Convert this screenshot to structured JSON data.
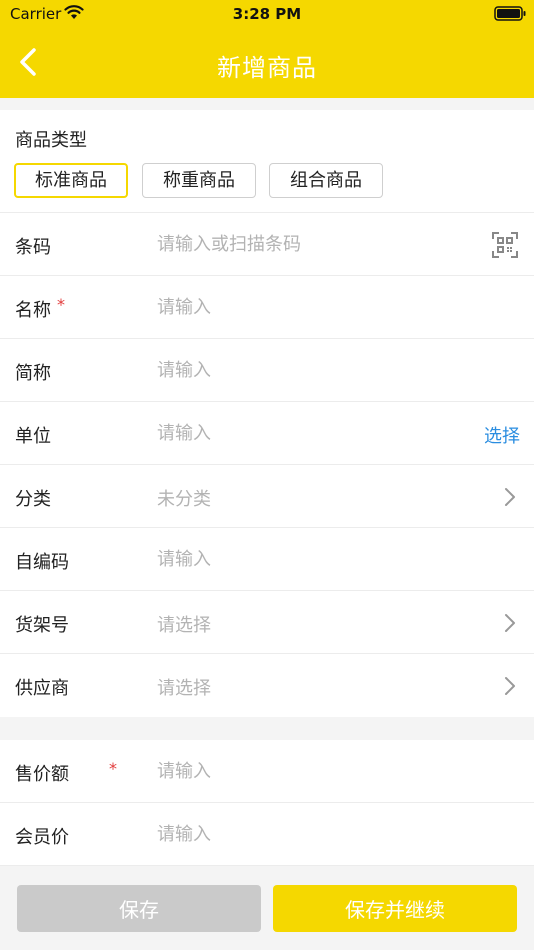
{
  "status_bar": {
    "carrier": "Carrier",
    "time": "3:28 PM"
  },
  "nav": {
    "title": "新增商品"
  },
  "product_type": {
    "label": "商品类型",
    "options": [
      "标准商品",
      "称重商品",
      "组合商品"
    ],
    "selected": "标准商品"
  },
  "fields": {
    "barcode": {
      "label": "条码",
      "placeholder": "请输入或扫描条码"
    },
    "name": {
      "label": "名称",
      "placeholder": "请输入",
      "required_mark": "*"
    },
    "short_name": {
      "label": "简称",
      "placeholder": "请输入"
    },
    "unit": {
      "label": "单位",
      "placeholder": "请输入",
      "action": "选择"
    },
    "category": {
      "label": "分类",
      "value": "未分类"
    },
    "custom_code": {
      "label": "自编码",
      "placeholder": "请输入"
    },
    "shelf_no": {
      "label": "货架号",
      "value": "请选择"
    },
    "supplier": {
      "label": "供应商",
      "value": "请选择"
    },
    "sale_price": {
      "label": "售价额",
      "placeholder": "请输入",
      "required_mark": "*"
    },
    "member_price": {
      "label": "会员价",
      "placeholder": "请输入"
    }
  },
  "buttons": {
    "save": "保存",
    "save_continue": "保存并继续"
  },
  "colors": {
    "brand_yellow": "#f5d800",
    "link_blue": "#2a8de0",
    "required_red": "#e23b3b",
    "disabled_gray": "#cacaca"
  }
}
